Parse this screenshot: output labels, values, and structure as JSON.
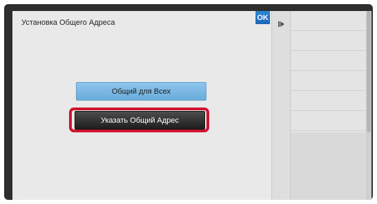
{
  "dialog": {
    "title": "Установка Общего Адреса",
    "ok_label": "OK"
  },
  "buttons": {
    "common_for_all": "Общий для Всех",
    "set_common_address": "Указать Общий Адрес"
  },
  "colors": {
    "ok_button": "#1f72c4",
    "common_for_all_button": "#79b6e3",
    "selected_button": "#2d2d2d",
    "highlight_frame": "#d0132f"
  },
  "side_panel": {
    "collapse_icon": "collapse-arrow-icon",
    "rows": 6
  }
}
